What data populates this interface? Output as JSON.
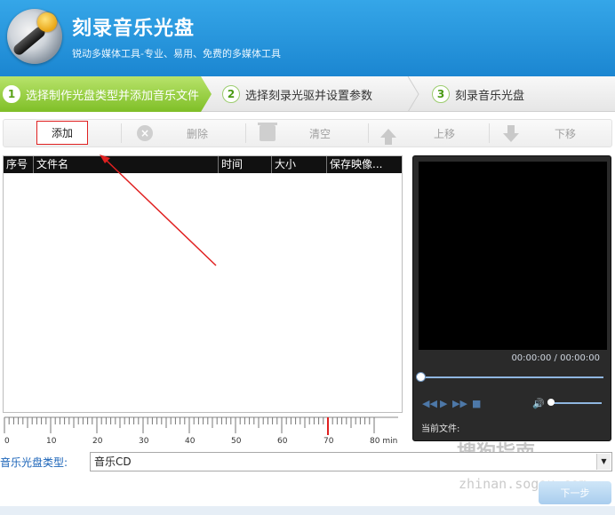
{
  "app": {
    "title": "刻录音乐光盘",
    "subtitle": "锐动多媒体工具-专业、易用、免费的多媒体工具"
  },
  "steps": [
    {
      "num": "1",
      "label": "选择制作光盘类型并添加音乐文件",
      "active": true
    },
    {
      "num": "2",
      "label": "选择刻录光驱并设置参数",
      "active": false
    },
    {
      "num": "3",
      "label": "刻录音乐光盘",
      "active": false
    }
  ],
  "toolbar": {
    "add": "添加",
    "delete": "删除",
    "clear": "清空",
    "move_up": "上移",
    "move_down": "下移"
  },
  "table": {
    "columns": [
      "序号",
      "文件名",
      "时间",
      "大小",
      "保存映像..."
    ],
    "rows": []
  },
  "ruler": {
    "labels": [
      "0",
      "10",
      "20",
      "30",
      "40",
      "50",
      "60",
      "70",
      "80 min"
    ],
    "max_minutes": 80,
    "marker_minutes": 70
  },
  "player": {
    "time": "00:00:00 / 00:00:00",
    "current_file_label": "当前文件:",
    "progress": 0,
    "volume": 0
  },
  "disc_type": {
    "label": "音乐光盘类型:",
    "value": "音乐CD"
  },
  "next_button": "下一步",
  "watermark": {
    "text": "搜狗指南",
    "url": "zhinan.sogou.com"
  },
  "colors": {
    "header": "#1b86d1",
    "step_active": "#7fbf27",
    "add_border": "#e02020",
    "annotation_arrow": "#e02020"
  }
}
